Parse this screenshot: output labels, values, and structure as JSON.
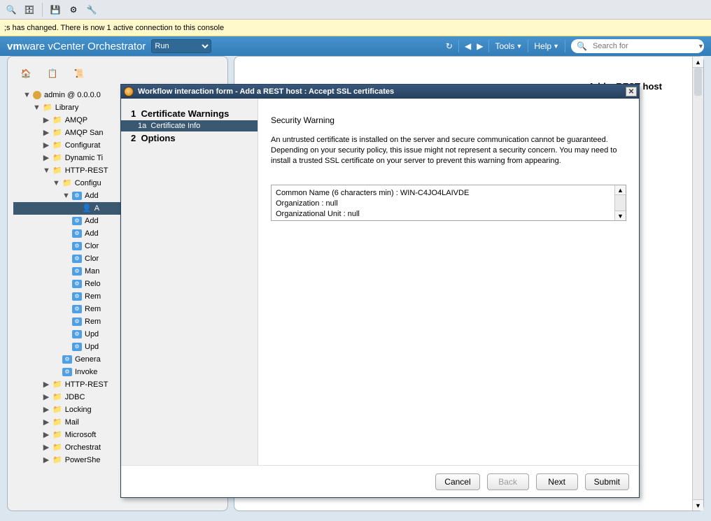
{
  "toolbarIcons": [
    {
      "name": "find-icon",
      "glyph": "🔍"
    },
    {
      "name": "db-icon",
      "glyph": "🗄"
    },
    {
      "name": "floppy-icon",
      "glyph": "💾"
    },
    {
      "name": "gear-icon",
      "glyph": "⚙"
    },
    {
      "name": "wrench-icon",
      "glyph": "🔧"
    }
  ],
  "notification": ";s has changed. There is now 1 active connection to this console",
  "brand": {
    "prefix": "vm",
    "mid": "ware",
    "product": " vCenter Orchestrator"
  },
  "header": {
    "mode_options": [
      "Run"
    ],
    "mode_selected": "Run",
    "tools_label": "Tools",
    "help_label": "Help",
    "search_placeholder": "Search for"
  },
  "rightPanelTitle": "Add a REST host",
  "tree": {
    "root": "admin @ 0.0.0.0",
    "library": "Library",
    "folders_l2": [
      "AMQP",
      "AMQP San",
      "Configurat",
      "Dynamic Ti"
    ],
    "httprest": "HTTP-REST",
    "configu": "Configu",
    "add_sel": "Add",
    "add_user_sel": "A",
    "workflows": [
      "Add",
      "Add",
      "Clor",
      "Clor",
      "Man",
      "Relo",
      "Rem",
      "Rem",
      "Rem",
      "Upd",
      "Upd"
    ],
    "workflows_l4": [
      "Genera",
      "Invoke"
    ],
    "folders_l3": [
      "HTTP-REST",
      "JDBC",
      "Locking",
      "Mail",
      "Microsoft",
      "Orchestrat",
      "PowerShe"
    ]
  },
  "dialog": {
    "title": "Workflow interaction form - Add a REST host : Accept SSL certificates",
    "steps": {
      "s1": {
        "num": "1",
        "label": "Certificate Warnings"
      },
      "s1a": {
        "num": "1a",
        "label": "Certificate Info"
      },
      "s2": {
        "num": "2",
        "label": "Options"
      }
    },
    "form": {
      "heading": "Security Warning",
      "body": "An untrusted certificate is installed on the server and secure communication cannot be guaranteed. Depending on your security policy, this issue might not represent a security concern. You may need to install a trusted SSL certificate on your server to prevent this warning from appearing.",
      "cert_lines": {
        "l1": "Common Name (6 characters min) : WIN-C4JO4LAIVDE",
        "l2": "Organization : null",
        "l3": "Organizational Unit : null"
      }
    },
    "buttons": {
      "cancel": "Cancel",
      "back": "Back",
      "next": "Next",
      "submit": "Submit"
    }
  }
}
